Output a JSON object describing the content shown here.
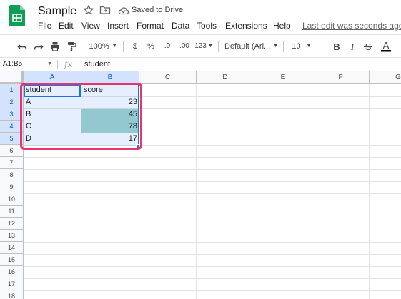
{
  "app": {
    "doc_title": "Sample",
    "saved_status": "Saved to Drive",
    "last_edit": "Last edit was seconds ago",
    "menu": [
      "File",
      "Edit",
      "View",
      "Insert",
      "Format",
      "Data",
      "Tools",
      "Extensions",
      "Help"
    ]
  },
  "toolbar": {
    "zoom": "100%",
    "currency": "$",
    "percent": "%",
    "decrease_decimal": ".0",
    "increase_decimal": ".00",
    "more_formats": "123",
    "font": "Default (Ari...",
    "font_size": "10",
    "icons": [
      "undo-icon",
      "redo-icon",
      "print-icon",
      "paint-format-icon",
      "bold-icon",
      "italic-icon",
      "strikethrough-icon",
      "text-color-icon"
    ]
  },
  "formula_bar": {
    "name_box": "A1:B5",
    "fx": "fx",
    "value": "student"
  },
  "sheet": {
    "columns": [
      "A",
      "B",
      "C",
      "D",
      "E",
      "F",
      "G"
    ],
    "rows": [
      "1",
      "2",
      "3",
      "4",
      "5",
      "6",
      "7",
      "8",
      "9",
      "10",
      "11",
      "12",
      "13",
      "14",
      "15",
      "16",
      "17",
      "18"
    ],
    "header": {
      "a": "student",
      "b": "score"
    },
    "data": [
      {
        "a": "A",
        "b": "23"
      },
      {
        "a": "B",
        "b": "45"
      },
      {
        "a": "C",
        "b": "78"
      },
      {
        "a": "D",
        "b": "17"
      }
    ],
    "highlight_color": "#a3d4cc",
    "selection_color": "#1a73e8",
    "annotation_color": "#e8336b"
  }
}
